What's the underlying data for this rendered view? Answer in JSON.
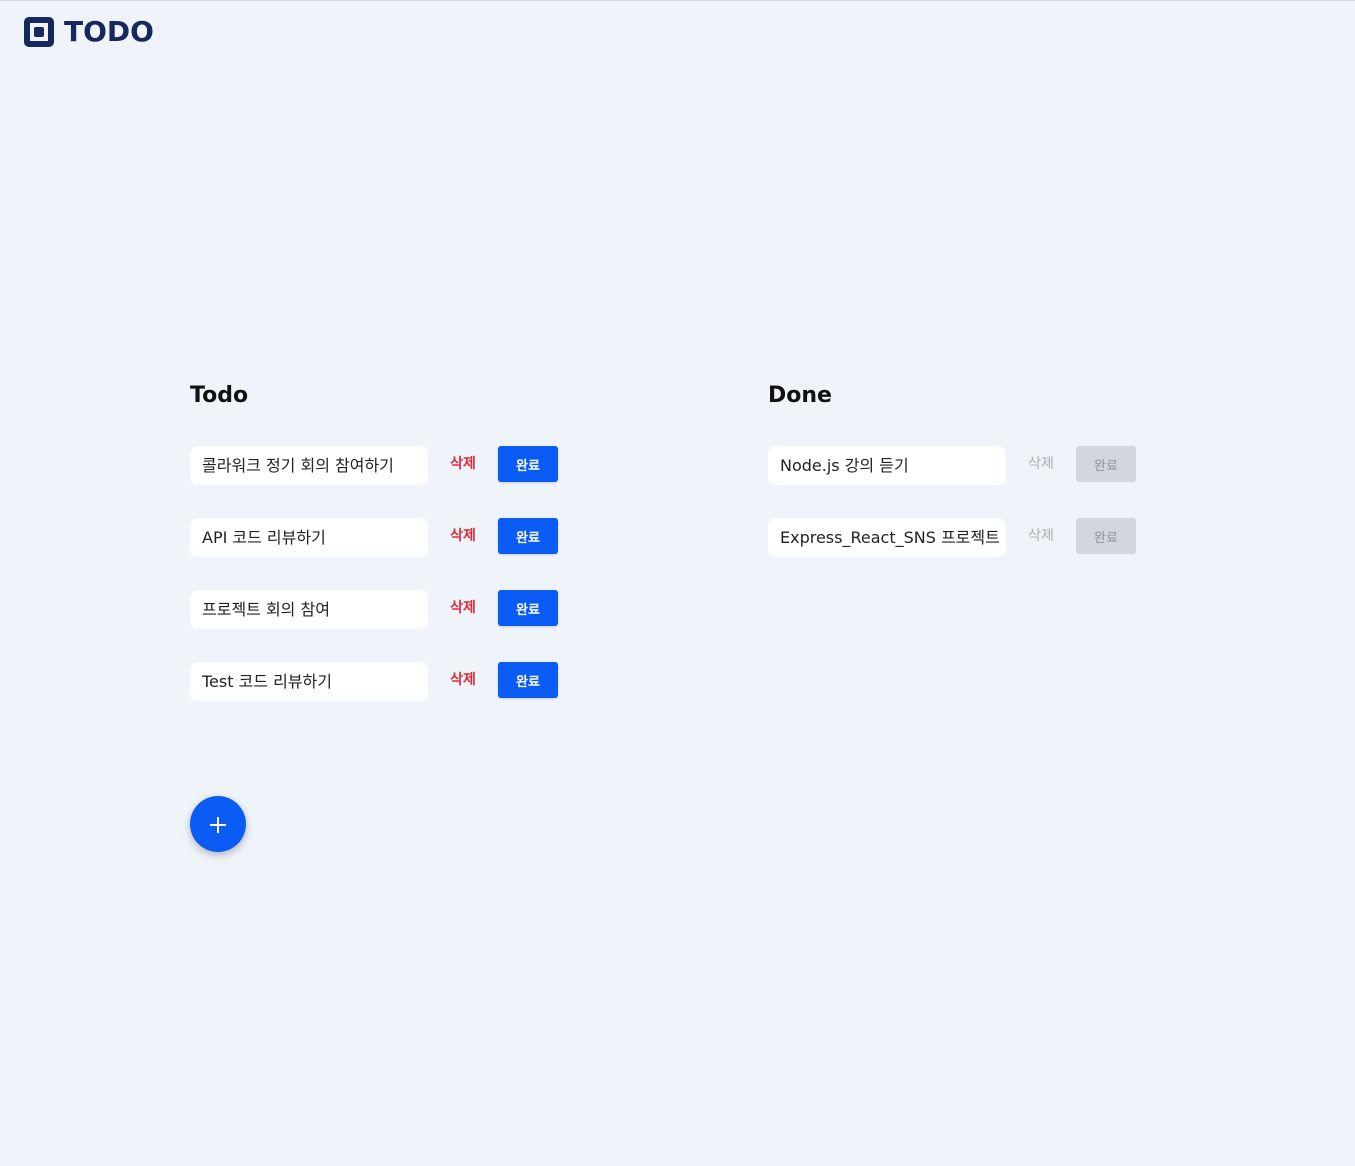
{
  "header": {
    "logo_text": "TODO"
  },
  "todo": {
    "title": "Todo",
    "items": [
      {
        "text": "콜라워크 정기 회의 참여하기",
        "delete_label": "삭제",
        "done_label": "완료"
      },
      {
        "text": "API 코드 리뷰하기",
        "delete_label": "삭제",
        "done_label": "완료"
      },
      {
        "text": "프로젝트 회의 참여",
        "delete_label": "삭제",
        "done_label": "완료"
      },
      {
        "text": "Test 코드 리뷰하기",
        "delete_label": "삭제",
        "done_label": "완료"
      }
    ]
  },
  "done": {
    "title": "Done",
    "items": [
      {
        "text": "Node.js 강의 듣기",
        "delete_label": "삭제",
        "done_label": "완료"
      },
      {
        "text": "Express_React_SNS 프로젝트",
        "delete_label": "삭제",
        "done_label": "완료"
      }
    ]
  },
  "add_button": {
    "icon": "plus-icon"
  },
  "colors": {
    "background": "#eff3fa",
    "brand": "#17295c",
    "accent": "#0a5cf5",
    "delete": "#e02b37",
    "disabled": "#d2d6dd"
  }
}
